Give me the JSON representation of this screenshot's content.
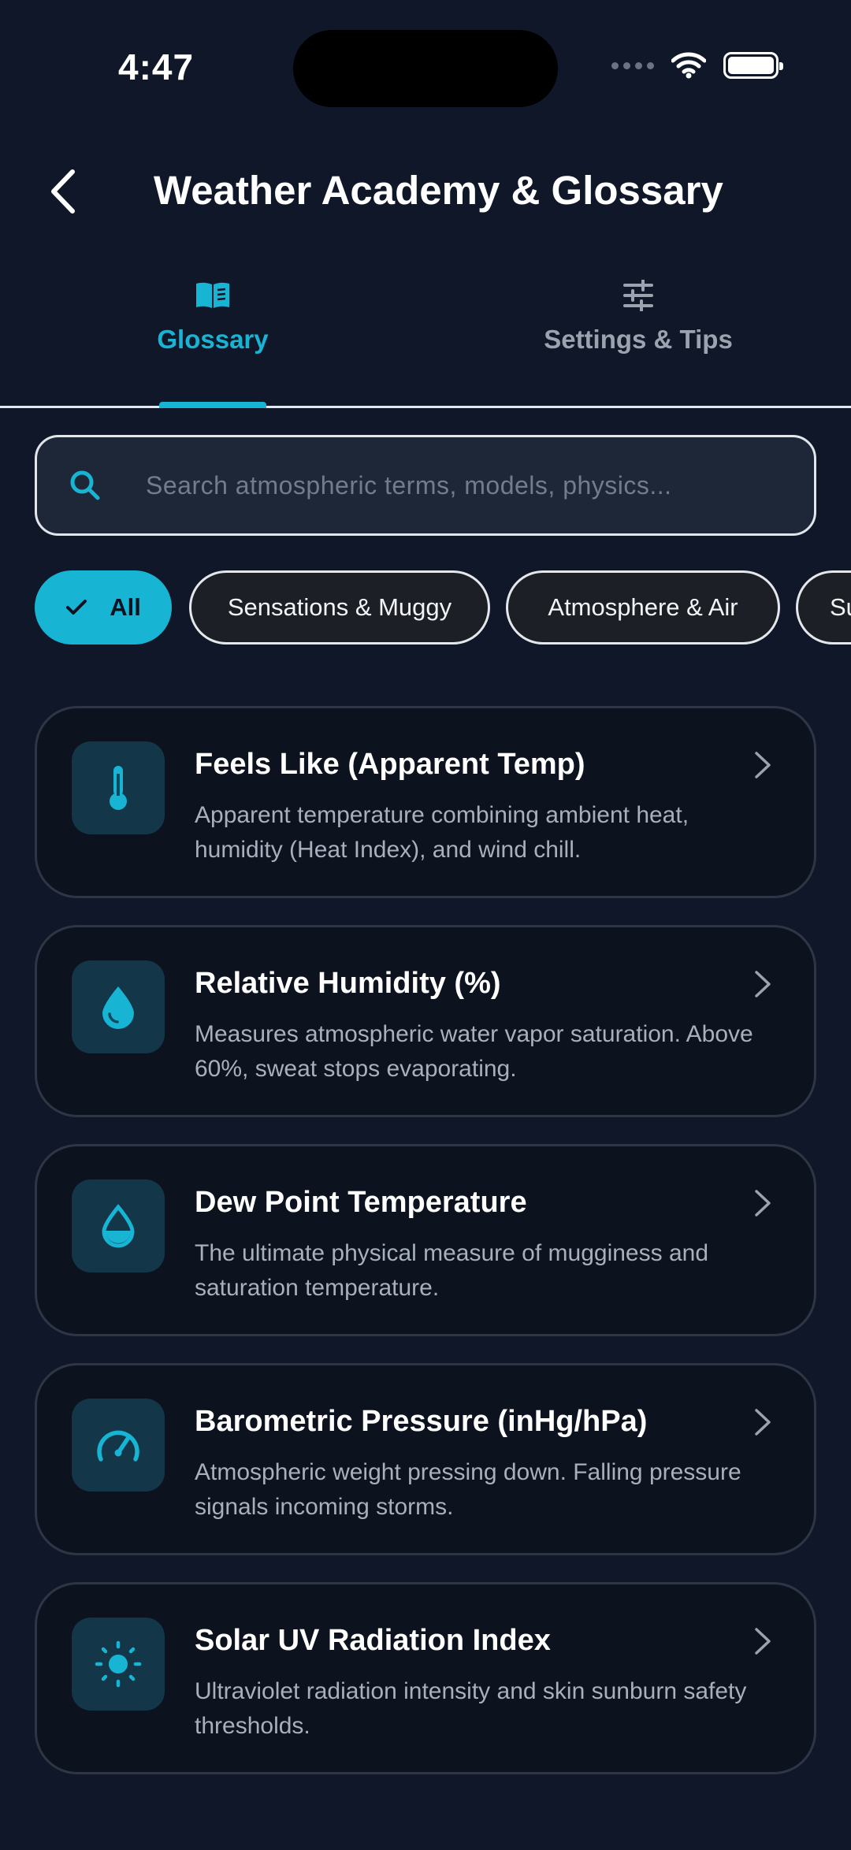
{
  "status_bar": {
    "time": "4:47"
  },
  "header": {
    "title": "Weather Academy & Glossary"
  },
  "tabs": [
    {
      "label": "Glossary",
      "icon": "book-icon",
      "active": true
    },
    {
      "label": "Settings & Tips",
      "icon": "sliders-icon",
      "active": false
    }
  ],
  "search": {
    "placeholder": "Search atmospheric terms, models, physics...",
    "value": ""
  },
  "chips": [
    {
      "label": "All",
      "selected": true
    },
    {
      "label": "Sensations & Muggy",
      "selected": false
    },
    {
      "label": "Atmosphere & Air",
      "selected": false
    },
    {
      "label": "Su",
      "selected": false
    }
  ],
  "cards": [
    {
      "title": "Feels Like (Apparent Temp)",
      "description": "Apparent temperature combining ambient heat, humidity (Heat Index), and wind chill.",
      "icon": "thermometer-icon"
    },
    {
      "title": "Relative Humidity (%)",
      "description": "Measures atmospheric water vapor saturation. Above 60%, sweat stops evaporating.",
      "icon": "water-drop-icon"
    },
    {
      "title": "Dew Point Temperature",
      "description": "The ultimate physical measure of mugginess and saturation temperature.",
      "icon": "dew-drop-icon"
    },
    {
      "title": "Barometric Pressure (inHg/hPa)",
      "description": "Atmospheric weight pressing down. Falling pressure signals incoming storms.",
      "icon": "gauge-icon"
    },
    {
      "title": "Solar UV Radiation Index",
      "description": "Ultraviolet radiation intensity and skin sunburn safety thresholds.",
      "icon": "sun-icon"
    }
  ],
  "colors": {
    "accent": "#18b4d4",
    "background": "#0f1729",
    "card_background": "#0c121e"
  }
}
